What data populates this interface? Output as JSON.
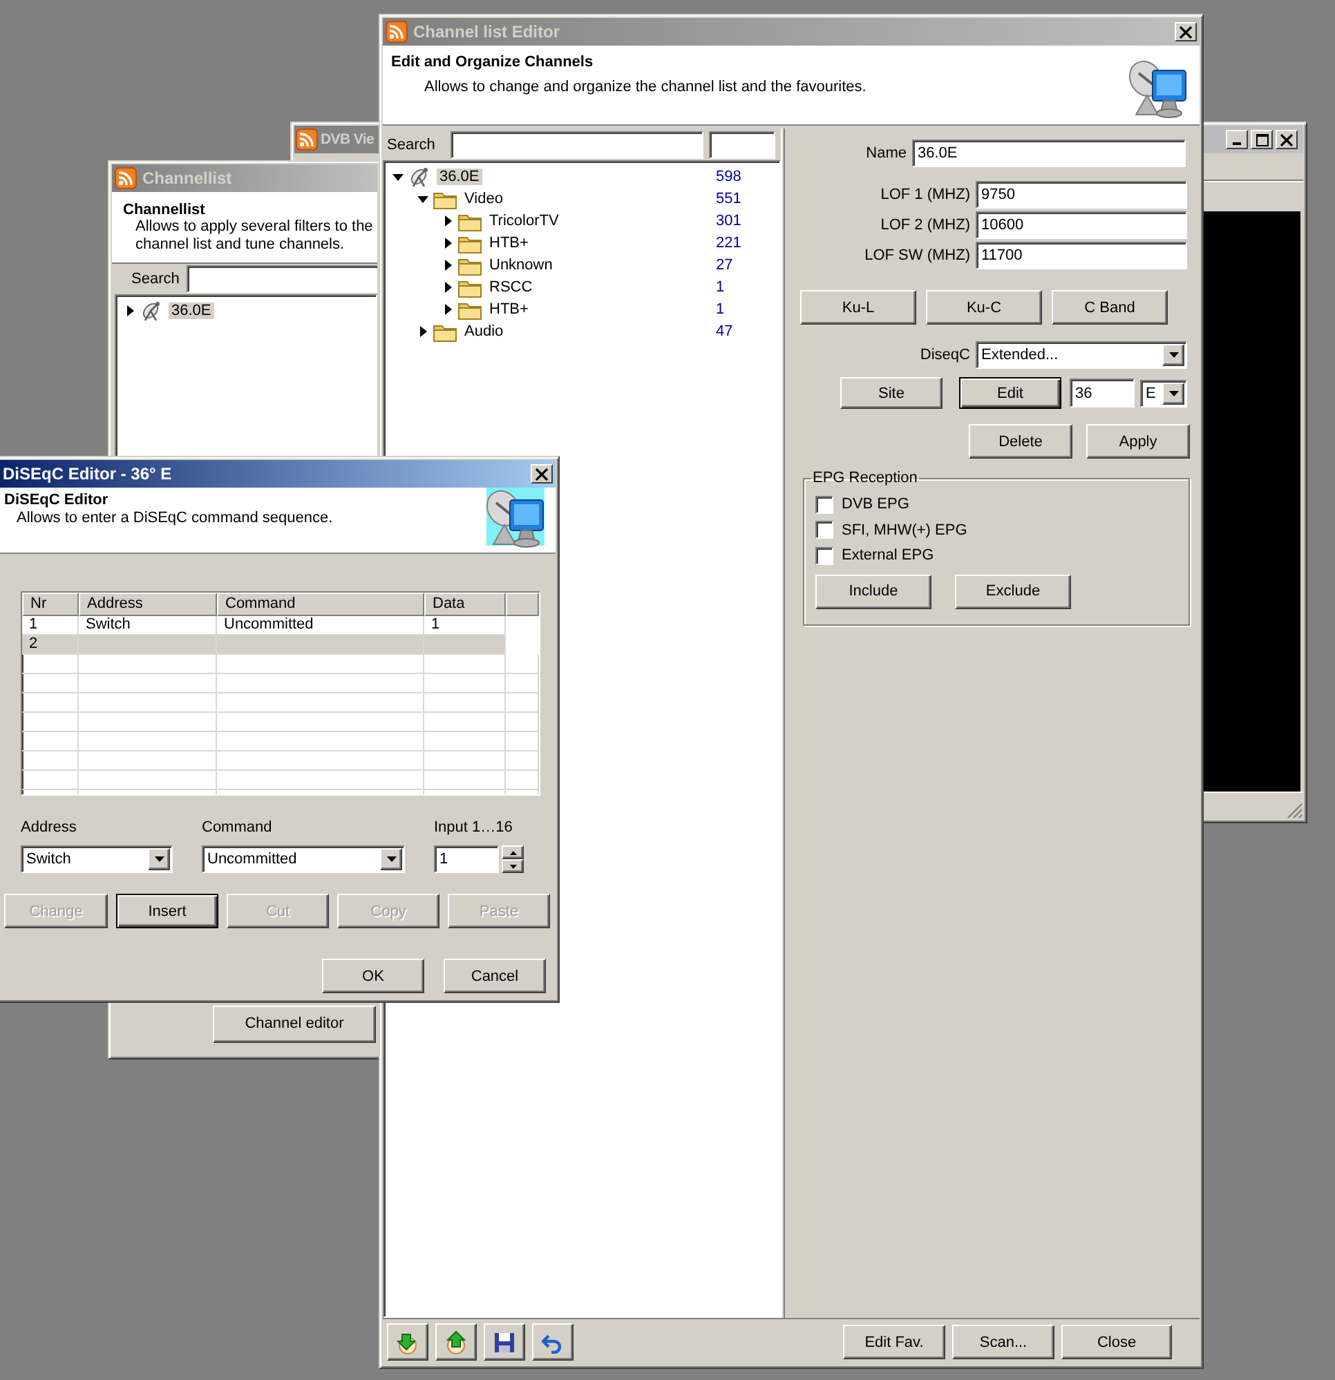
{
  "dvb_viewer": {
    "title": "DVB Vie",
    "active": false
  },
  "channellist": {
    "title": "Channellist",
    "active": false,
    "heading": "Channellist",
    "description": "Allows to apply several filters to the channel list and tune channels.",
    "search_label": "Search",
    "tree": [
      {
        "label": "36.0E",
        "kind": "satellite",
        "expanded": false,
        "selected": true
      }
    ],
    "button": "Channel editor"
  },
  "channel_list_editor": {
    "title": "Channel list Editor",
    "active": false,
    "heading": "Edit and Organize Channels",
    "description": "Allows to change and organize the channel list and the favourites.",
    "search_label": "Search",
    "tree": [
      {
        "label": "36.0E",
        "count": "598",
        "kind": "satellite",
        "expanded": true,
        "selected": true,
        "children": [
          {
            "label": "Video",
            "count": "551",
            "kind": "folder",
            "expanded": true,
            "selected": false,
            "children": [
              {
                "label": "TricolorTV",
                "count": "301",
                "kind": "folder",
                "expanded": false,
                "selected": false
              },
              {
                "label": "HTB+",
                "count": "221",
                "kind": "folder",
                "expanded": false,
                "selected": false
              },
              {
                "label": "Unknown",
                "count": "27",
                "kind": "folder",
                "expanded": false,
                "selected": false
              },
              {
                "label": "RSCC",
                "count": "1",
                "kind": "folder",
                "expanded": false,
                "selected": false
              },
              {
                "label": "HTB+",
                "count": "1",
                "kind": "folder",
                "expanded": false,
                "selected": false
              }
            ]
          },
          {
            "label": "Audio",
            "count": "47",
            "kind": "folder",
            "expanded": false,
            "selected": false
          }
        ]
      }
    ],
    "name": {
      "label": "Name",
      "value": "36.0E"
    },
    "lof_fields": [
      {
        "label": "LOF 1 (MHZ)",
        "value": "9750"
      },
      {
        "label": "LOF 2 (MHZ)",
        "value": "10600"
      },
      {
        "label": "LOF SW (MHZ)",
        "value": "11700"
      }
    ],
    "band_buttons": [
      "Ku-L",
      "Ku-C",
      "C Band"
    ],
    "diseqc": {
      "label": "DiseqC",
      "value": "Extended..."
    },
    "position": {
      "buttons": [
        {
          "label": "Site",
          "default": false
        },
        {
          "label": "Edit",
          "default": true
        }
      ],
      "degrees": "36",
      "direction": "E"
    },
    "actions": [
      "Delete",
      "Apply"
    ],
    "epg": {
      "title": "EPG Reception",
      "options": [
        {
          "label": "DVB EPG",
          "checked": false
        },
        {
          "label": "SFI, MHW(+) EPG",
          "checked": false
        },
        {
          "label": "External EPG",
          "checked": false
        }
      ],
      "buttons": [
        "Include",
        "Exclude"
      ]
    },
    "footer_buttons": [
      "Edit Fav.",
      "Scan...",
      "Close"
    ]
  },
  "diseqc_editor": {
    "title": "DiSEqC Editor - 36° E",
    "active": true,
    "heading": "DiSEqC Editor",
    "description": "Allows to enter a DiSEqC command sequence.",
    "table": {
      "columns": [
        "Nr",
        "Address",
        "Command",
        "Data"
      ],
      "rows": [
        {
          "cells": [
            "1",
            "Switch",
            "Uncommitted",
            "1"
          ],
          "selected": false
        },
        {
          "cells": [
            "2"
          ],
          "selected": true
        }
      ]
    },
    "address": {
      "label": "Address",
      "value": "Switch"
    },
    "command": {
      "label": "Command",
      "value": "Uncommitted"
    },
    "input": {
      "label": "Input 1…16",
      "value": "1"
    },
    "buttons": [
      {
        "label": "Change",
        "disabled": true,
        "default": false
      },
      {
        "label": "Insert",
        "disabled": false,
        "default": true
      },
      {
        "label": "Cut",
        "disabled": true,
        "default": false
      },
      {
        "label": "Copy",
        "disabled": true,
        "default": false
      },
      {
        "label": "Paste",
        "disabled": true,
        "default": false
      }
    ],
    "dialog_buttons": [
      "OK",
      "Cancel"
    ]
  }
}
